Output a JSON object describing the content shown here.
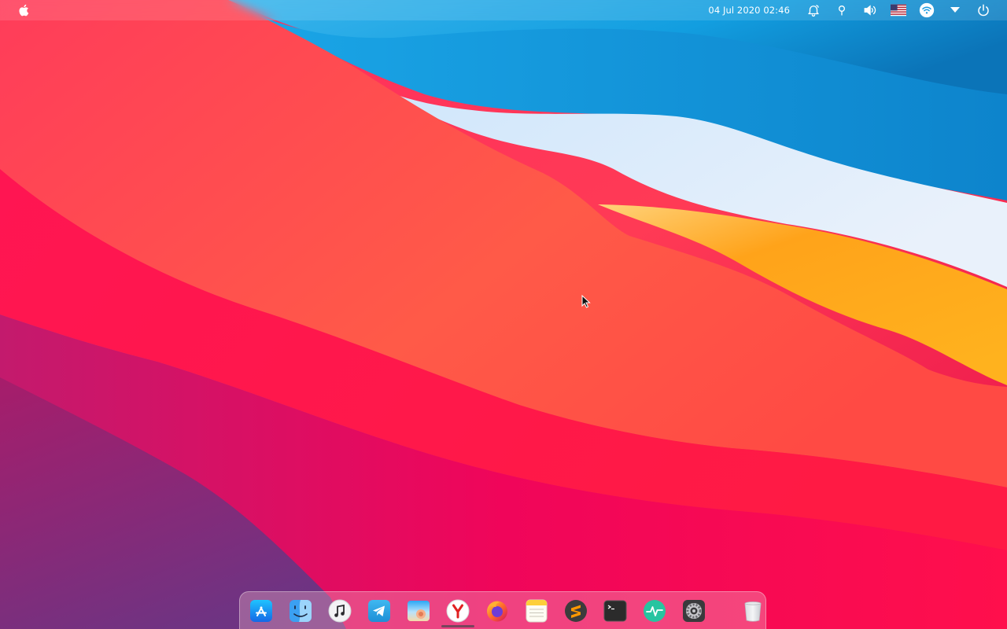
{
  "topbar": {
    "clock_text": "04 Jul 2020 02:46",
    "tray_icons": [
      "notification-bell-icon",
      "lightbulb-icon",
      "volume-icon",
      "us-flag-keyboard-layout-icon",
      "wifi-icon",
      "dropdown-arrow-icon",
      "power-icon"
    ]
  },
  "dock": {
    "apps": [
      "app-store-icon",
      "finder-icon",
      "music-icon",
      "telegram-icon",
      "image-viewer-icon",
      "yandex-browser-icon",
      "firefox-icon",
      "notes-icon",
      "sublime-text-icon",
      "terminal-icon",
      "activity-monitor-icon",
      "system-preferences-icon",
      "trash-icon"
    ],
    "active_app": "yandex-browser-icon"
  },
  "colors": {
    "wallpaper_red": "#ff2a55",
    "wallpaper_blue": "#1b9be0",
    "wallpaper_orange": "#ffa31a",
    "wallpaper_purple": "#6b3a84",
    "topbar_text": "#ffffff"
  }
}
